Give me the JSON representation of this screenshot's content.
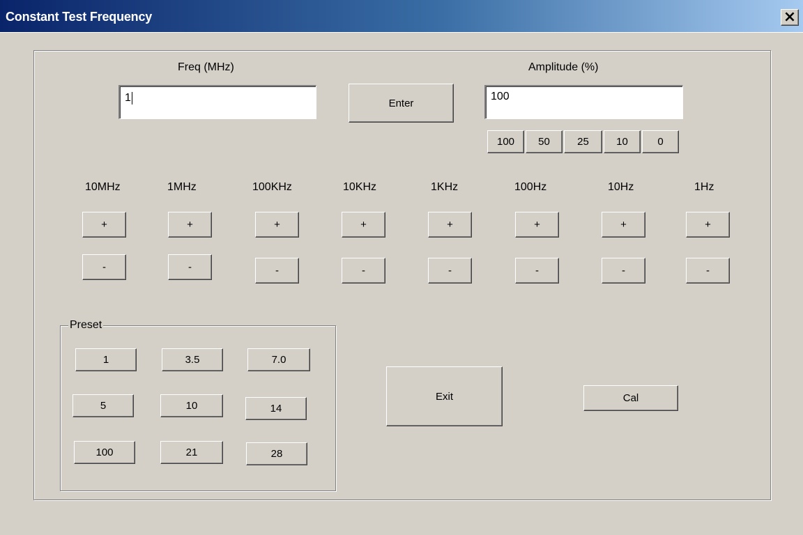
{
  "window": {
    "title": "Constant Test Frequency",
    "close_label": "×"
  },
  "frequency": {
    "label": "Freq (MHz)",
    "value": "1"
  },
  "enter_button": "Enter",
  "amplitude": {
    "label": "Amplitude (%)",
    "value": "100",
    "quick_buttons": [
      "100",
      "50",
      "25",
      "10",
      "0"
    ]
  },
  "steps": {
    "units": [
      "10MHz",
      "1MHz",
      "100KHz",
      "10KHz",
      "1KHz",
      "100Hz",
      "10Hz",
      "1Hz"
    ],
    "plus_label": "+",
    "minus_label": "-"
  },
  "preset": {
    "label": "Preset",
    "buttons": [
      "1",
      "3.5",
      "7.0",
      "5",
      "10",
      "14",
      "100",
      "21",
      "28"
    ]
  },
  "exit_button": "Exit",
  "cal_button": "Cal",
  "colors": {
    "face": "#d4d0c8",
    "title_start": "#0a246a",
    "title_end": "#a6caf0"
  }
}
